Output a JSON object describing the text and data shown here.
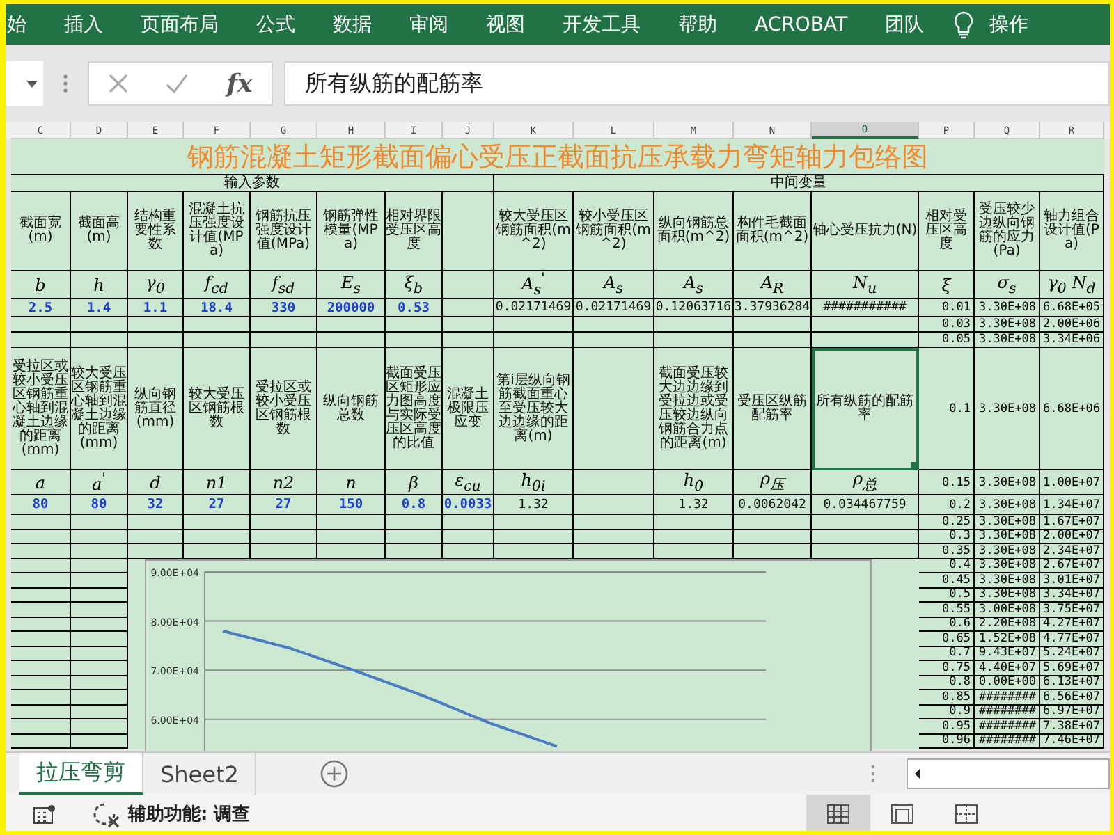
{
  "ribbon": {
    "tabs": [
      "始",
      "插入",
      "页面布局",
      "公式",
      "数据",
      "审阅",
      "视图",
      "开发工具",
      "帮助",
      "ACROBAT",
      "团队"
    ],
    "tell_me": "操作"
  },
  "formula_bar": {
    "fx": "fx",
    "content": "所有纵筋的配筋率"
  },
  "column_headers": [
    {
      "label": "C",
      "selected": false
    },
    {
      "label": "D",
      "selected": false
    },
    {
      "label": "E",
      "selected": false
    },
    {
      "label": "F",
      "selected": false
    },
    {
      "label": "G",
      "selected": false
    },
    {
      "label": "H",
      "selected": false
    },
    {
      "label": "I",
      "selected": false
    },
    {
      "label": "J",
      "selected": false
    },
    {
      "label": "K",
      "selected": false
    },
    {
      "label": "L",
      "selected": false
    },
    {
      "label": "M",
      "selected": false
    },
    {
      "label": "N",
      "selected": false
    },
    {
      "label": "O",
      "selected": true
    },
    {
      "label": "P",
      "selected": false
    },
    {
      "label": "Q",
      "selected": false
    },
    {
      "label": "R",
      "selected": false
    }
  ],
  "sheet": {
    "title": "钢筋混凝土矩形截面偏心受压正截面抗压承载力弯矩轴力包络图",
    "sections": [
      "输入参数",
      "中间变量"
    ],
    "inputs": [
      {
        "label": "截面宽(m)",
        "symbol": "b",
        "value": "2.5",
        "kind": "input",
        "selected": false
      },
      {
        "label": "截面高(m)",
        "symbol": "h",
        "value": "1.4",
        "kind": "input",
        "selected": false
      },
      {
        "label": "结构重要性系数",
        "symbol": "γ$_{0}$",
        "value": "1.1",
        "kind": "input",
        "selected": false
      },
      {
        "label": "混凝土抗压强度设计值(MPa)",
        "symbol": "f$_{cd}$",
        "value": "18.4",
        "kind": "input",
        "selected": false
      },
      {
        "label": "钢筋抗压强度设计值(MPa)",
        "symbol": "f$_{sd}$",
        "value": "330",
        "kind": "input",
        "selected": false
      },
      {
        "label": "钢筋弹性模量(MPa)",
        "symbol": "E$_{s}$",
        "value": "200000",
        "kind": "input",
        "selected": false
      },
      {
        "label": "相对界限受压区高度",
        "symbol": "ξ$_{b}$",
        "value": "0.53",
        "kind": "input",
        "selected": false
      }
    ],
    "intermediates": [
      {
        "label": "较大受压区钢筋面积(m^2)",
        "symbol": "A$_{s}$$^{'}$",
        "value": "0.02171469",
        "kind": "calc",
        "selected": false
      },
      {
        "label": "较小受压区钢筋面积(m^2)",
        "symbol": "A$_{s}$",
        "value": "0.02171469",
        "kind": "calc",
        "selected": false
      },
      {
        "label": "纵向钢筋总面积(m^2)",
        "symbol": "A$_{s}$",
        "value": "0.12063716",
        "kind": "calc",
        "selected": false
      },
      {
        "label": "构件毛截面面积(m^2)",
        "symbol": "A$_{R}$",
        "value": "3.37936284",
        "kind": "calc",
        "selected": false
      },
      {
        "label": "轴心受压抗力(N)",
        "symbol": "N$_{u}$",
        "value": "###########",
        "kind": "calc",
        "selected": false
      }
    ],
    "xi_columns": [
      {
        "label": "相对受压区高度",
        "symbol": "ξ"
      },
      {
        "label": "受压较少边纵向钢筋的应力(Pa)",
        "symbol": "σ$_{s}$"
      },
      {
        "label": "轴力组合设计值(Pa)",
        "symbol": "γ$_{0}$ N$_{d}$"
      }
    ],
    "xi_rows": [
      [
        "0.01",
        "3.30E+08",
        "6.68E+05"
      ],
      [
        "0.03",
        "3.30E+08",
        "2.00E+06"
      ],
      [
        "0.05",
        "3.30E+08",
        "3.34E+06"
      ],
      [
        "0.1",
        "3.30E+08",
        "6.68E+06"
      ],
      [
        "0.15",
        "3.30E+08",
        "1.00E+07"
      ],
      [
        "0.2",
        "3.30E+08",
        "1.34E+07"
      ],
      [
        "0.25",
        "3.30E+08",
        "1.67E+07"
      ],
      [
        "0.3",
        "3.30E+08",
        "2.00E+07"
      ],
      [
        "0.35",
        "3.30E+08",
        "2.34E+07"
      ],
      [
        "0.4",
        "3.30E+08",
        "2.67E+07"
      ],
      [
        "0.45",
        "3.30E+08",
        "3.01E+07"
      ],
      [
        "0.5",
        "3.30E+08",
        "3.34E+07"
      ],
      [
        "0.55",
        "3.00E+08",
        "3.75E+07"
      ],
      [
        "0.6",
        "2.20E+08",
        "4.27E+07"
      ],
      [
        "0.65",
        "1.52E+08",
        "4.77E+07"
      ],
      [
        "0.7",
        "9.43E+07",
        "5.24E+07"
      ],
      [
        "0.75",
        "4.40E+07",
        "5.69E+07"
      ],
      [
        "0.8",
        "0.00E+00",
        "6.13E+07"
      ],
      [
        "0.85",
        "########",
        "6.56E+07"
      ],
      [
        "0.9",
        "########",
        "6.97E+07"
      ],
      [
        "0.95",
        "########",
        "7.38E+07"
      ],
      [
        "0.96",
        "########",
        "7.46E+07"
      ]
    ],
    "params_2": [
      {
        "label": "受拉区或较小受压区钢筋重心轴到混凝土边缘的距离(mm)",
        "symbol": "a",
        "value": "80",
        "kind": "input",
        "selected": false
      },
      {
        "label": "较大受压区钢筋重心轴到混凝土边缘的距离(mm)",
        "symbol": "a$^{'}$",
        "value": "80",
        "kind": "input",
        "selected": false
      },
      {
        "label": "纵向钢筋直径(mm)",
        "symbol": "d",
        "value": "32",
        "kind": "input",
        "selected": false
      },
      {
        "label": "较大受压区钢筋根数",
        "symbol": "n1",
        "value": "27",
        "kind": "input",
        "selected": false
      },
      {
        "label": "受拉区或较小受压区钢筋根数",
        "symbol": "n2",
        "value": "27",
        "kind": "input",
        "selected": false
      },
      {
        "label": "纵向钢筋总数",
        "symbol": "n",
        "value": "150",
        "kind": "input",
        "selected": false
      },
      {
        "label": "截面受压区矩形应力图高度与实际受压区高度的比值",
        "symbol": "β",
        "value": "0.8",
        "kind": "input",
        "selected": false
      },
      {
        "label": "混凝土极限压应变",
        "symbol": "ε$_{cu}$",
        "value": "0.0033",
        "kind": "input",
        "selected": false
      },
      {
        "label": "第i层纵向钢筋截面重心至受压较大边边缘的距离(m)",
        "symbol": "h$_{0i}$",
        "value": "1.32",
        "kind": "calc",
        "selected": false
      }
    ],
    "params_3": [
      {
        "label": "截面受压较大边边缘到受拉边或受压较边纵向钢筋合力点的距离(m)",
        "symbol": "h$_{0}$",
        "value": "1.32",
        "kind": "calc",
        "selected": false
      },
      {
        "label": "受压区纵筋配筋率",
        "symbol": "ρ$_{压}$",
        "value": "0.0062042",
        "kind": "calc",
        "selected": false
      },
      {
        "label": "所有纵筋的配筋率",
        "symbol": "ρ$_{总}$",
        "value": "0.034467759",
        "kind": "calc",
        "selected": true
      }
    ]
  },
  "chart": {
    "chart_data": {
      "type": "line",
      "grid": true,
      "ylim": [
        50000,
        90000
      ],
      "yticks": [
        {
          "value": 60000,
          "label": "6.00E+04"
        },
        {
          "value": 70000,
          "label": "7.00E+04"
        },
        {
          "value": 80000,
          "label": "8.00E+04"
        },
        {
          "value": 90000,
          "label": "9.00E+04"
        }
      ],
      "series": [
        {
          "color": "#4a7cc4",
          "values": [
            78000,
            74500,
            69800,
            64800,
            59200,
            54500
          ]
        }
      ]
    }
  },
  "sheet_tabs": [
    {
      "label": "拉压弯剪",
      "selected": true
    },
    {
      "label": "Sheet2",
      "selected": false
    }
  ],
  "status_bar": {
    "accessibility": "辅助功能: 调查",
    "views": [
      {
        "kind": "normal",
        "selected": true
      },
      {
        "kind": "page_layout",
        "selected": false
      },
      {
        "kind": "page_break",
        "selected": false
      }
    ]
  }
}
